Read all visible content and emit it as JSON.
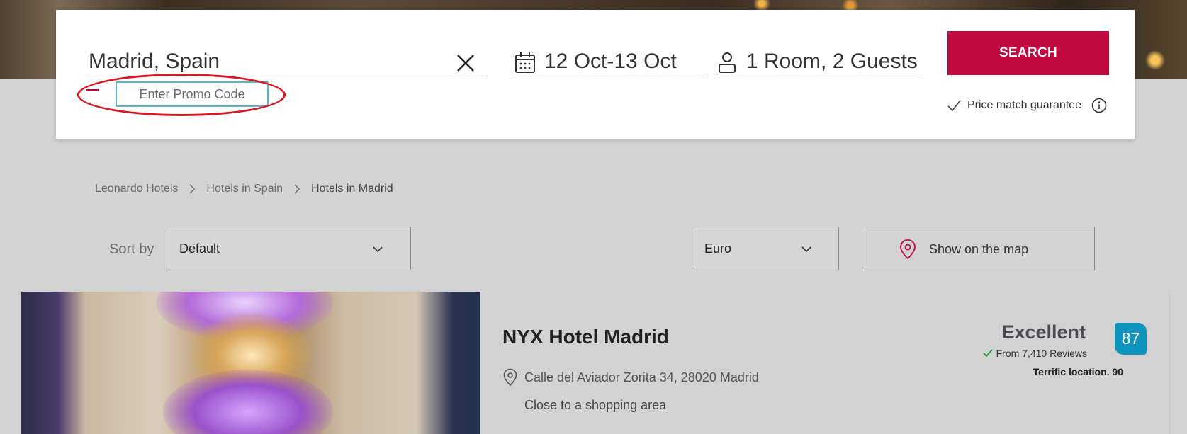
{
  "search": {
    "destination": "Madrid, Spain",
    "dates": "12 Oct-13 Oct",
    "guests": "1 Room, 2 Guests",
    "search_label": "SEARCH",
    "promo_placeholder": "Enter Promo Code",
    "price_match": "Price match guarantee"
  },
  "breadcrumb": [
    "Leonardo Hotels",
    "Hotels in Spain",
    "Hotels in Madrid"
  ],
  "sort": {
    "label": "Sort by",
    "value": "Default"
  },
  "currency": {
    "value": "Euro"
  },
  "map_button": {
    "label": "Show on the map"
  },
  "hotel": {
    "name": "NYX Hotel Madrid",
    "address": "Calle del Aviador Zorita 34, 28020 Madrid",
    "feature": "Close to a shopping area",
    "rating_word": "Excellent",
    "score": "87",
    "reviews": "From 7,410 Reviews",
    "location": "Terrific location. 90"
  },
  "colors": {
    "brand": "#c0093e",
    "badge": "#0f95bd",
    "promo_border": "#56b8cf",
    "annotation": "#e0161f"
  }
}
